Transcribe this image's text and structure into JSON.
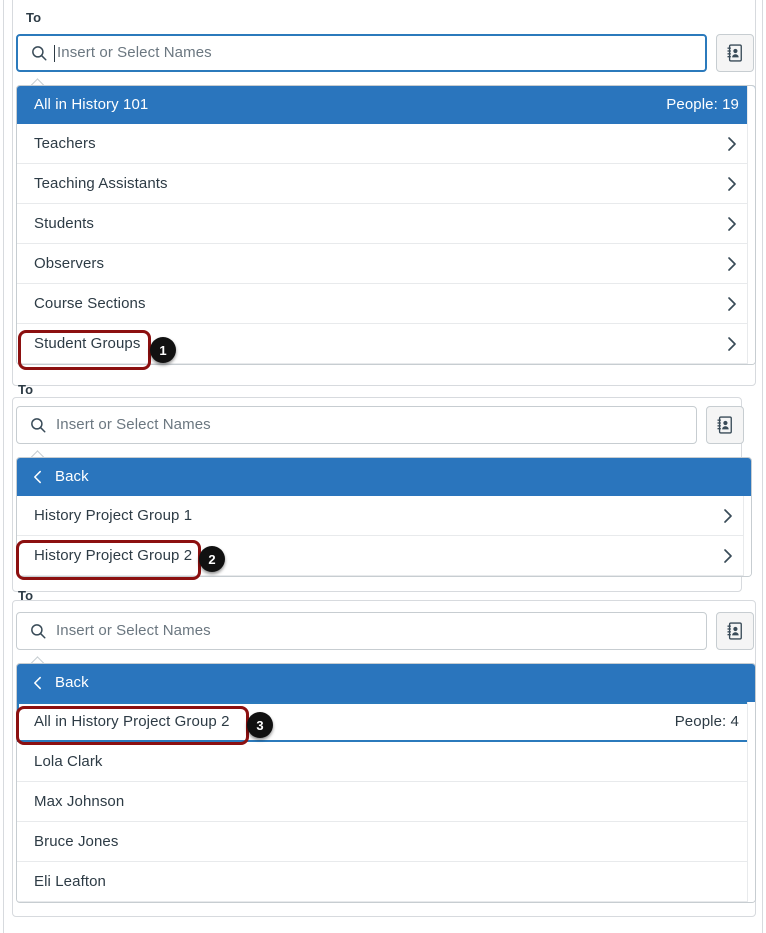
{
  "colors": {
    "accent_blue": "#2A75BD",
    "focus_blue": "#2B7ABC",
    "callout_red": "#8C1010",
    "badge_black": "#111111",
    "text": "#2D3B45",
    "border": "#C7CDD1",
    "button_bg": "#F5F5F5"
  },
  "panels": [
    {
      "to_label": "To",
      "search": {
        "placeholder": "Insert or Select Names",
        "value": "",
        "icon": "search-icon",
        "focused": true,
        "caret_visible": true
      },
      "address_book_button": {
        "icon": "address-book-icon",
        "title": "Address Book"
      },
      "menu": {
        "header": {
          "label": "All in History 101",
          "meta": "People: 19"
        },
        "items": [
          {
            "label": "Teachers",
            "chevron": "chevron-right-icon"
          },
          {
            "label": "Teaching Assistants",
            "chevron": "chevron-right-icon"
          },
          {
            "label": "Students",
            "chevron": "chevron-right-icon"
          },
          {
            "label": "Observers",
            "chevron": "chevron-right-icon"
          },
          {
            "label": "Course Sections",
            "chevron": "chevron-right-icon"
          },
          {
            "label": "Student Groups",
            "chevron": "chevron-right-icon"
          }
        ]
      },
      "callout": {
        "number": "1",
        "target": "Student Groups"
      }
    },
    {
      "to_label": "To",
      "search": {
        "placeholder": "Insert or Select Names",
        "value": "",
        "icon": "search-icon",
        "focused": false,
        "caret_visible": false
      },
      "address_book_button": {
        "icon": "address-book-icon",
        "title": "Address Book"
      },
      "menu": {
        "back": {
          "label": "Back",
          "icon": "chevron-left-icon"
        },
        "items": [
          {
            "label": "History Project Group 1",
            "chevron": "chevron-right-icon"
          },
          {
            "label": "History Project Group 2",
            "chevron": "chevron-right-icon"
          }
        ]
      },
      "callout": {
        "number": "2",
        "target": "History Project Group 2"
      }
    },
    {
      "to_label": "To",
      "search": {
        "placeholder": "Insert or Select Names",
        "value": "",
        "icon": "search-icon",
        "focused": false,
        "caret_visible": false
      },
      "address_book_button": {
        "icon": "address-book-icon",
        "title": "Address Book"
      },
      "menu": {
        "back": {
          "label": "Back",
          "icon": "chevron-left-icon"
        },
        "header_row": {
          "label": "All in History Project Group 2",
          "meta": "People: 4",
          "selected": true
        },
        "items": [
          {
            "label": "Lola Clark"
          },
          {
            "label": "Max Johnson"
          },
          {
            "label": "Bruce Jones"
          },
          {
            "label": "Eli Leafton"
          }
        ]
      },
      "callout": {
        "number": "3",
        "target": "All in History Project Group 2"
      }
    }
  ]
}
